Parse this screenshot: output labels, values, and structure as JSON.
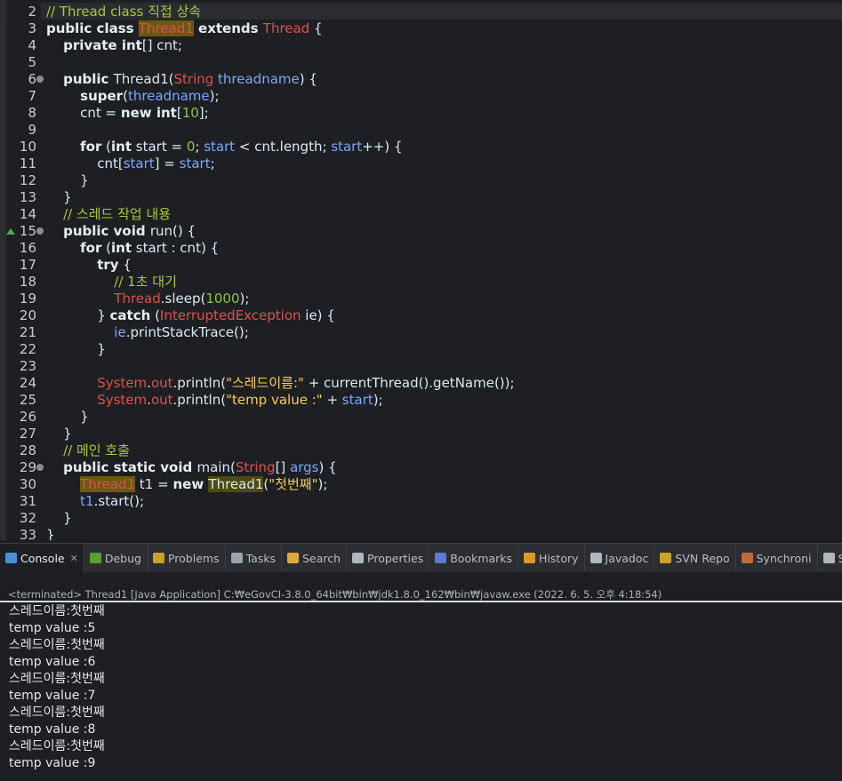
{
  "editor": {
    "lines": [
      {
        "n": "2",
        "parts": [
          [
            "cm",
            "// Thread class 직접 상속"
          ]
        ]
      },
      {
        "n": "3",
        "parts": [
          [
            "kw",
            "public class "
          ],
          [
            "ty",
            "Thread1"
          ],
          [
            "",
            "",
            ""
          ],
          [
            "kw",
            " extends "
          ],
          [
            "ty",
            "Thread"
          ],
          [
            "",
            " {"
          ]
        ]
      },
      {
        "n": "4",
        "parts": [
          [
            "",
            "    "
          ],
          [
            "kw",
            "private int"
          ],
          [
            "",
            "[] cnt;"
          ]
        ]
      },
      {
        "n": "5",
        "parts": []
      },
      {
        "n": "6",
        "fold": true,
        "parts": [
          [
            "",
            "    "
          ],
          [
            "kw",
            "public "
          ],
          [
            "",
            "Thread1("
          ],
          [
            "ty",
            "String"
          ],
          [
            "",
            " "
          ],
          [
            "fld",
            "threadname"
          ],
          [
            "",
            ") {"
          ]
        ]
      },
      {
        "n": "7",
        "parts": [
          [
            "",
            "        "
          ],
          [
            "kw",
            "super"
          ],
          [
            "",
            "("
          ],
          [
            "fld",
            "threadname"
          ],
          [
            "",
            ");"
          ]
        ]
      },
      {
        "n": "8",
        "parts": [
          [
            "",
            "        cnt = "
          ],
          [
            "kw",
            "new int"
          ],
          [
            "",
            "["
          ],
          [
            "num",
            "10"
          ],
          [
            "",
            "];"
          ]
        ]
      },
      {
        "n": "9",
        "parts": []
      },
      {
        "n": "10",
        "parts": [
          [
            "",
            "        "
          ],
          [
            "kw",
            "for"
          ],
          [
            "",
            " ("
          ],
          [
            "kw",
            "int"
          ],
          [
            "",
            " start = "
          ],
          [
            "num",
            "0"
          ],
          [
            "",
            "; "
          ],
          [
            "fld",
            "start"
          ],
          [
            "",
            " < cnt.length; "
          ],
          [
            "fld",
            "start"
          ],
          [
            "",
            "++) {"
          ]
        ]
      },
      {
        "n": "11",
        "parts": [
          [
            "",
            "            cnt["
          ],
          [
            "fld",
            "start"
          ],
          [
            "",
            "] = "
          ],
          [
            "fld",
            "start"
          ],
          [
            "",
            ";"
          ]
        ]
      },
      {
        "n": "12",
        "parts": [
          [
            "",
            "        }"
          ]
        ]
      },
      {
        "n": "13",
        "parts": [
          [
            "",
            "    }"
          ]
        ]
      },
      {
        "n": "14",
        "parts": [
          [
            "",
            "    "
          ],
          [
            "cm",
            "// 스레드 작업 내용"
          ]
        ]
      },
      {
        "n": "15",
        "fold": true,
        "override": true,
        "parts": [
          [
            "",
            "    "
          ],
          [
            "kw",
            "public void "
          ],
          [
            "",
            "run() {"
          ]
        ]
      },
      {
        "n": "16",
        "parts": [
          [
            "",
            "        "
          ],
          [
            "kw",
            "for"
          ],
          [
            "",
            " ("
          ],
          [
            "kw",
            "int"
          ],
          [
            "",
            " start : cnt) {"
          ]
        ]
      },
      {
        "n": "17",
        "parts": [
          [
            "",
            "            "
          ],
          [
            "kw",
            "try"
          ],
          [
            "",
            " {"
          ]
        ]
      },
      {
        "n": "18",
        "parts": [
          [
            "",
            "                "
          ],
          [
            "cm",
            "// 1초 대기"
          ]
        ]
      },
      {
        "n": "19",
        "parts": [
          [
            "",
            "                "
          ],
          [
            "ty",
            "Thread"
          ],
          [
            "",
            ".sleep("
          ],
          [
            "num",
            "1000"
          ],
          [
            "",
            ");"
          ]
        ]
      },
      {
        "n": "20",
        "parts": [
          [
            "",
            "            } "
          ],
          [
            "kw",
            "catch"
          ],
          [
            "",
            " ("
          ],
          [
            "ty",
            "InterruptedException"
          ],
          [
            "",
            " ie) {"
          ]
        ]
      },
      {
        "n": "21",
        "parts": [
          [
            "",
            "                "
          ],
          [
            "fld",
            "ie"
          ],
          [
            "",
            ".printStackTrace();"
          ]
        ]
      },
      {
        "n": "22",
        "parts": [
          [
            "",
            "            }"
          ]
        ]
      },
      {
        "n": "23",
        "parts": []
      },
      {
        "n": "24",
        "parts": [
          [
            "",
            "            "
          ],
          [
            "ty",
            "System"
          ],
          [
            "",
            "."
          ],
          [
            "ty",
            "out"
          ],
          [
            "",
            ".println("
          ],
          [
            "str",
            "\"스레드이름:\""
          ],
          [
            "",
            " + currentThread().getName());"
          ]
        ]
      },
      {
        "n": "25",
        "parts": [
          [
            "",
            "            "
          ],
          [
            "ty",
            "System"
          ],
          [
            "",
            "."
          ],
          [
            "ty",
            "out"
          ],
          [
            "",
            ".println("
          ],
          [
            "str",
            "\"temp value :\""
          ],
          [
            "",
            " + "
          ],
          [
            "fld",
            "start"
          ],
          [
            "",
            ");"
          ]
        ]
      },
      {
        "n": "26",
        "parts": [
          [
            "",
            "        }"
          ]
        ]
      },
      {
        "n": "27",
        "parts": [
          [
            "",
            "    }"
          ]
        ]
      },
      {
        "n": "28",
        "parts": [
          [
            "",
            "    "
          ],
          [
            "cm",
            "// 메인 호출"
          ]
        ]
      },
      {
        "n": "29",
        "fold": true,
        "parts": [
          [
            "",
            "    "
          ],
          [
            "kw",
            "public static void "
          ],
          [
            "",
            "main("
          ],
          [
            "ty",
            "String"
          ],
          [
            "",
            "[] "
          ],
          [
            "fld",
            "args"
          ],
          [
            "",
            ") {"
          ]
        ]
      },
      {
        "n": "30",
        "parts": [
          [
            "",
            "        "
          ],
          [
            "tyhl",
            "Thread1"
          ],
          [
            "",
            " t1 = "
          ],
          [
            "kw",
            "new "
          ],
          [
            "hl2",
            "Thread1"
          ],
          [
            "",
            "("
          ],
          [
            "str",
            "\"첫번째\""
          ],
          [
            "",
            ");"
          ]
        ]
      },
      {
        "n": "31",
        "parts": [
          [
            "",
            "        "
          ],
          [
            "fld",
            "t1"
          ],
          [
            "",
            ".start();"
          ]
        ]
      },
      {
        "n": "32",
        "parts": [
          [
            "",
            "    }"
          ]
        ]
      },
      {
        "n": "33",
        "parts": [
          [
            "",
            "}"
          ]
        ]
      }
    ]
  },
  "tabs": [
    {
      "label": "Console",
      "icon": "console-icon",
      "color": "#4a8fd8",
      "active": true,
      "closable": true
    },
    {
      "label": "Debug",
      "icon": "bug-icon",
      "color": "#5aa02c"
    },
    {
      "label": "Problems",
      "icon": "problems-icon",
      "color": "#c9a227"
    },
    {
      "label": "Tasks",
      "icon": "tasks-icon",
      "color": "#9aa4ad"
    },
    {
      "label": "Search",
      "icon": "search-icon",
      "color": "#e0a93b"
    },
    {
      "label": "Properties",
      "icon": "properties-icon",
      "color": "#b0b6bd"
    },
    {
      "label": "Bookmarks",
      "icon": "bookmark-icon",
      "color": "#5b7bd5"
    },
    {
      "label": "History",
      "icon": "history-icon",
      "color": "#d89a2b"
    },
    {
      "label": "Javadoc",
      "icon": "javadoc-icon",
      "color": "#b0b6bd"
    },
    {
      "label": "SVN Repo",
      "icon": "svn-icon",
      "color": "#c9a227"
    },
    {
      "label": "Synchroni",
      "icon": "sync-icon",
      "color": "#c26b3a"
    },
    {
      "label": "SQL Result",
      "icon": "sql-result-icon",
      "color": "#b0b6bd"
    },
    {
      "label": "",
      "icon": "overflow-icon",
      "color": "#4a8fd8"
    }
  ],
  "console": {
    "status": "<terminated> Thread1 [Java Application] C:₩eGovCI-3.8.0_64bit₩bin₩jdk1.8.0_162₩bin₩javaw.exe (2022. 6. 5. 오후 4:18:54)",
    "output": [
      "스레드이름:첫번째",
      "temp value :5",
      "스레드이름:첫번째",
      "temp value :6",
      "스레드이름:첫번째",
      "temp value :7",
      "스레드이름:첫번째",
      "temp value :8",
      "스레드이름:첫번째",
      "temp value :9"
    ]
  }
}
